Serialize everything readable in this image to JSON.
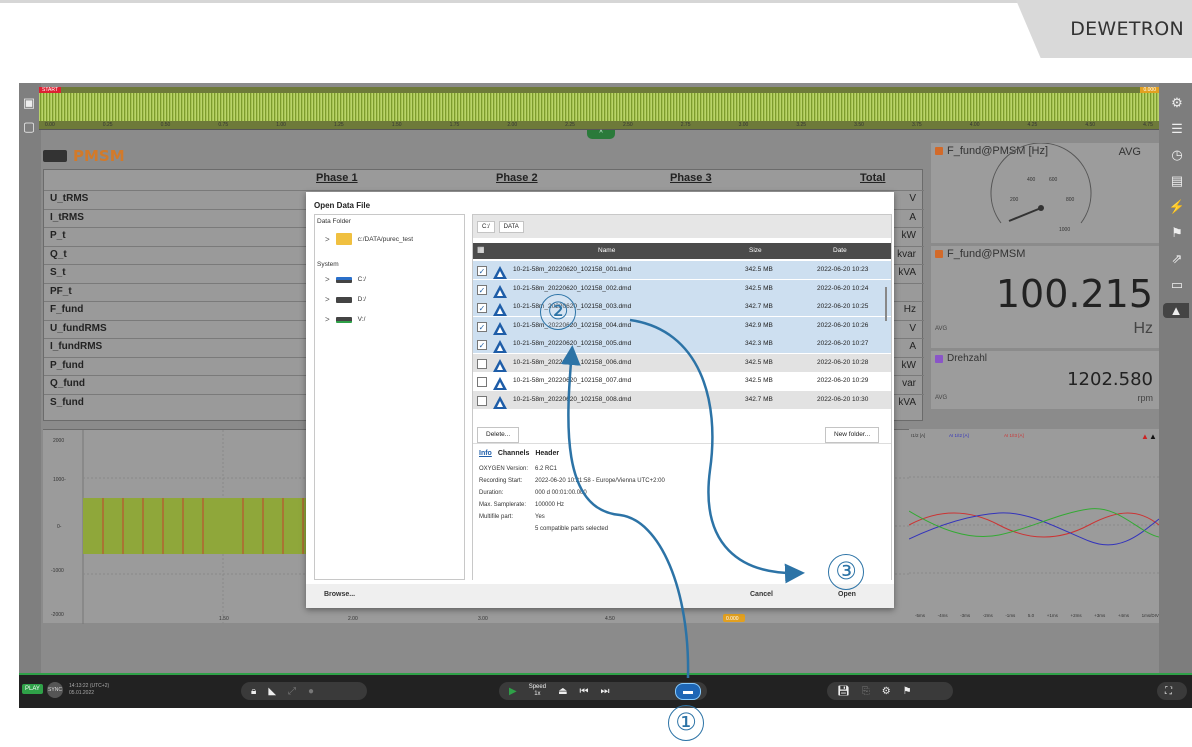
{
  "brand": "DEWETRON",
  "overview": {
    "start_tag": "START",
    "end_tag": "0.000",
    "ticks": [
      "0.00",
      "0.25",
      "0.50",
      "0.75",
      "1.00",
      "1.25",
      "1.50",
      "1.75",
      "2.00",
      "2.25",
      "2.50",
      "2.75",
      "3.00",
      "3.25",
      "3.50",
      "3.75",
      "4.00",
      "4.25",
      "4.50",
      "4.75"
    ]
  },
  "panel_title": "PMSM",
  "table": {
    "headers": [
      "Phase 1",
      "Phase 2",
      "Phase 3",
      "Total"
    ],
    "rows": [
      {
        "label": "U_tRMS",
        "unit": "V"
      },
      {
        "label": "I_tRMS",
        "unit": "A"
      },
      {
        "label": "P_t",
        "unit": "kW"
      },
      {
        "label": "Q_t",
        "unit": "kvar"
      },
      {
        "label": "S_t",
        "unit": "kVA"
      },
      {
        "label": "PF_t",
        "unit": ""
      },
      {
        "label": "F_fund",
        "unit": "Hz"
      },
      {
        "label": "U_fundRMS",
        "unit": "V"
      },
      {
        "label": "I_fundRMS",
        "unit": "A"
      },
      {
        "label": "P_fund",
        "unit": "kW"
      },
      {
        "label": "Q_fund",
        "unit": "var"
      },
      {
        "label": "S_fund",
        "unit": "kVA"
      }
    ]
  },
  "gauge": {
    "title": "F_fund@PMSM [Hz]",
    "mode": "AVG",
    "ticks": [
      "200",
      "400",
      "600",
      "800",
      "1000"
    ],
    "color": "#d26a2a"
  },
  "digital": {
    "title": "F_fund@PMSM",
    "value": "100.215",
    "unit": "Hz",
    "mode": "AVG",
    "color": "#d26a2a"
  },
  "rpm": {
    "title": "Drehzahl",
    "value": "1202.580",
    "unit": "rpm",
    "mode": "AVG",
    "color": "#8a55c8"
  },
  "left_chart": {
    "yticks": [
      "2000",
      "1000-",
      "0-",
      "-1000",
      "-2000"
    ],
    "xticks": [
      "1.50",
      "2.00",
      "3.00",
      "4.50"
    ],
    "marker": "0.000"
  },
  "right_chart": {
    "legend": [
      "I1/2 [A]",
      "AI 1/I2 [A]",
      "AI 1/I3 [A]"
    ],
    "xticks": [
      "-5ms",
      "-4ms",
      "-3ms",
      "-2ms",
      "-1ms",
      "5.0",
      "+1ms",
      "+2ms",
      "+3ms",
      "+4ms",
      "1ms/DIV"
    ]
  },
  "bottombar": {
    "play": "PLAY",
    "sync": "SYNC",
    "time": "14:13:22 (UTC+2)",
    "date": "05.01.2022",
    "speed_label": "Speed",
    "speed": "1x"
  },
  "dialog": {
    "title": "Open Data File",
    "data_folder_label": "Data Folder",
    "data_folder_path": "c:/DATA/purec_test",
    "system_label": "System",
    "drives": [
      "C:/",
      "D:/",
      "V:/"
    ],
    "breadcrumbs": [
      "C:/",
      "DATA"
    ],
    "columns": {
      "name": "Name",
      "size": "Size",
      "date": "Date"
    },
    "files": [
      {
        "name": "10-21-58m_20220620_102158_001.dmd",
        "size": "342.5 MB",
        "date": "2022-06-20 10:23",
        "checked": true,
        "state": "sel"
      },
      {
        "name": "10-21-58m_20220620_102158_002.dmd",
        "size": "342.5 MB",
        "date": "2022-06-20 10:24",
        "checked": true,
        "state": "sel"
      },
      {
        "name": "10-21-58m_20220620_102158_003.dmd",
        "size": "342.7 MB",
        "date": "2022-06-20 10:25",
        "checked": true,
        "state": "sel"
      },
      {
        "name": "10-21-58m_20220620_102158_004.dmd",
        "size": "342.9 MB",
        "date": "2022-06-20 10:26",
        "checked": true,
        "state": "sel"
      },
      {
        "name": "10-21-58m_20220620_102158_005.dmd",
        "size": "342.3 MB",
        "date": "2022-06-20 10:27",
        "checked": true,
        "state": "sel"
      },
      {
        "name": "10-21-58m_20220620_102158_006.dmd",
        "size": "342.5 MB",
        "date": "2022-06-20 10:28",
        "checked": false,
        "state": "gray"
      },
      {
        "name": "10-21-58m_20220620_102158_007.dmd",
        "size": "342.5 MB",
        "date": "2022-06-20 10:29",
        "checked": false,
        "state": "white"
      },
      {
        "name": "10-21-58m_20220620_102158_008.dmd",
        "size": "342.7 MB",
        "date": "2022-06-20 10:30",
        "checked": false,
        "state": "gray"
      }
    ],
    "delete_label": "Delete...",
    "new_folder_label": "New folder...",
    "tabs": [
      "Info",
      "Channels",
      "Header"
    ],
    "info": [
      {
        "k": "OXYGEN Version:",
        "v": "6.2 RC1"
      },
      {
        "k": "Recording Start:",
        "v": "2022-06-20 10:21:58 - Europe/Vienna UTC+2:00"
      },
      {
        "k": "Duration:",
        "v": "000 d 00:01:00.000"
      },
      {
        "k": "Max. Samplerate:",
        "v": "100000 Hz"
      },
      {
        "k": "Multifile part:",
        "v": "Yes"
      },
      {
        "k": "",
        "v": "5 compatible parts selected"
      }
    ],
    "browse_label": "Browse...",
    "cancel_label": "Cancel",
    "open_label": "Open"
  },
  "callouts": [
    "①",
    "②",
    "③"
  ]
}
